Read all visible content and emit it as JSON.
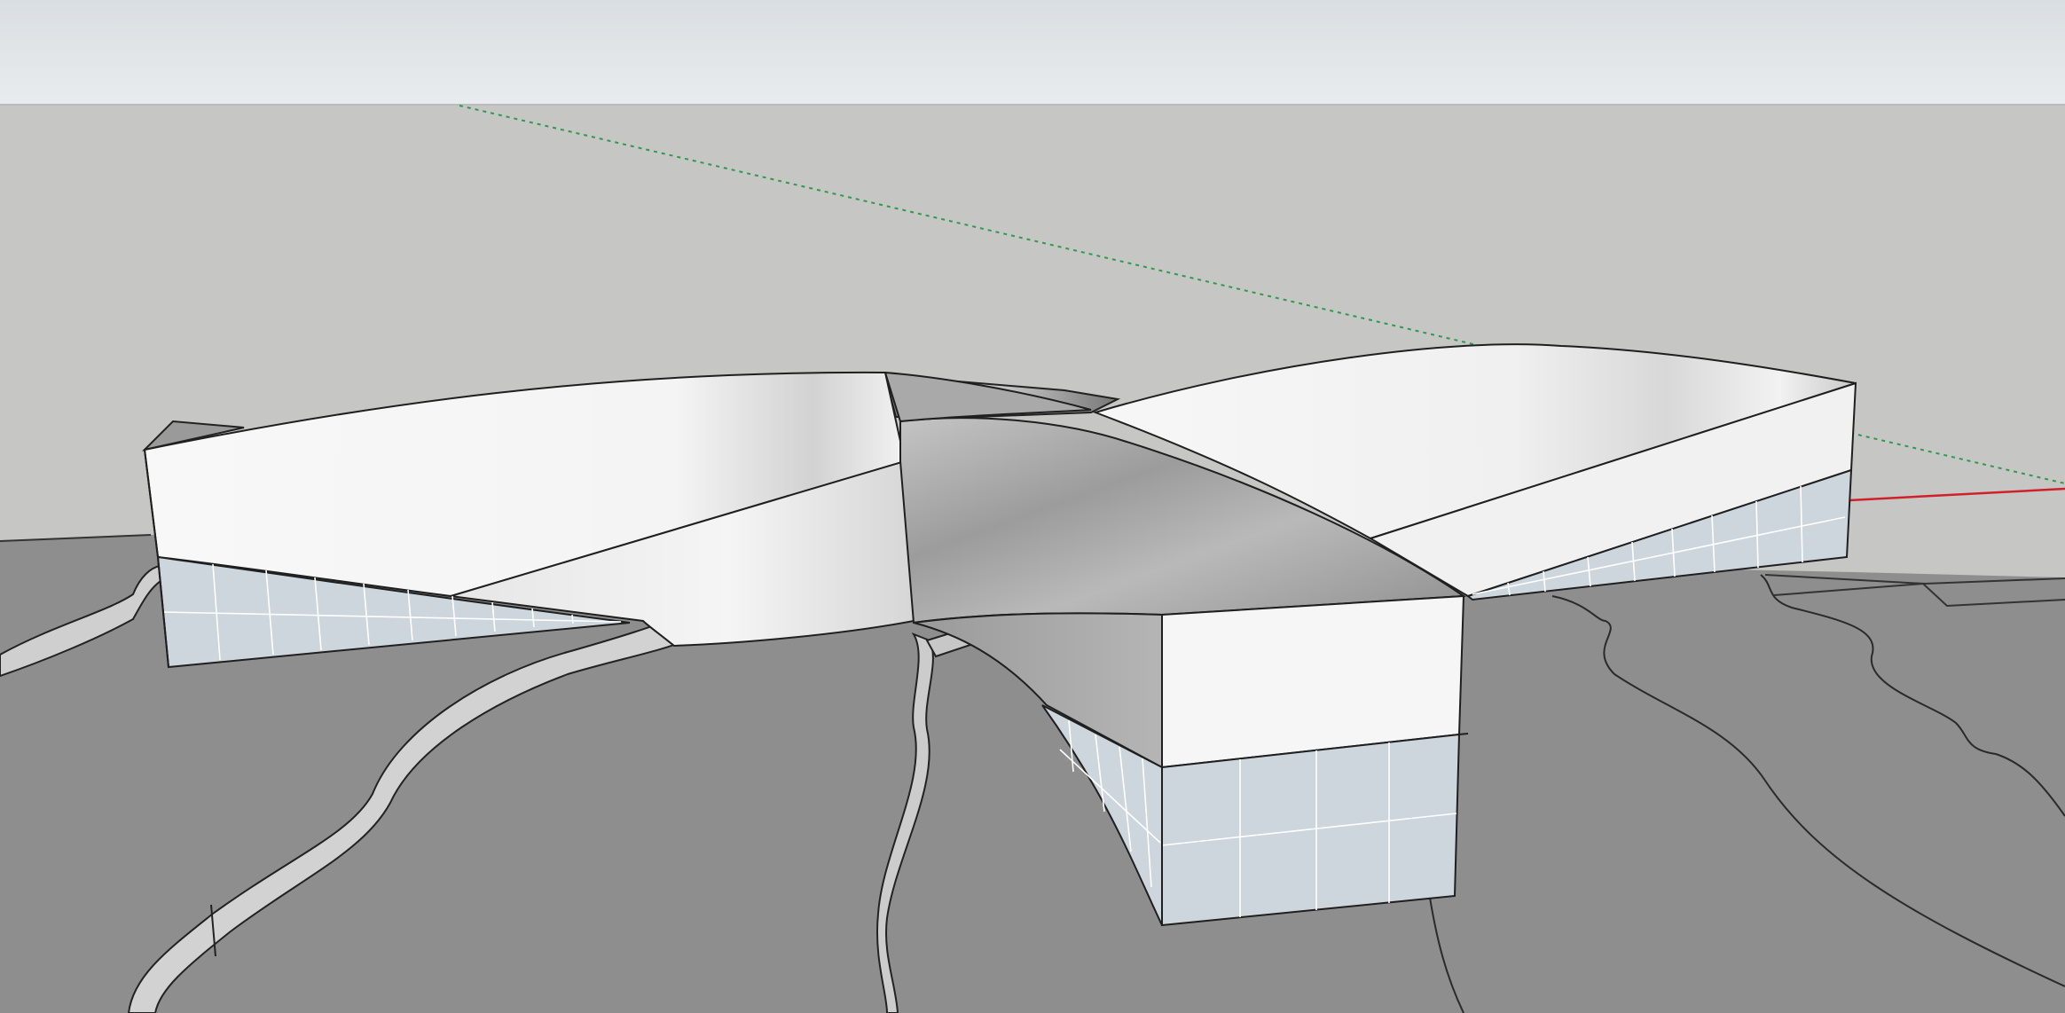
{
  "viewport": {
    "style": "sketchup-3d-model-view",
    "colors": {
      "sky_top": "#dfe3e6",
      "sky_bottom": "#e8ebed",
      "backdrop": "#c6c6c4",
      "ground": "#8e8e8e",
      "face_white": "#f7f7f7",
      "face_shadow": "#bdbdbd",
      "glass": "#cdd5dd",
      "edge": "#1f1f1f",
      "mullion": "#ffffff",
      "axis_green": "#2e9a4e",
      "axis_red": "#d0202a"
    }
  },
  "model": {
    "description_icon": "curved-building-icon",
    "has_glazing": true,
    "contour_terrain": true
  },
  "axes": {
    "green_axis_dashed": true,
    "red_axis_solid": true
  }
}
